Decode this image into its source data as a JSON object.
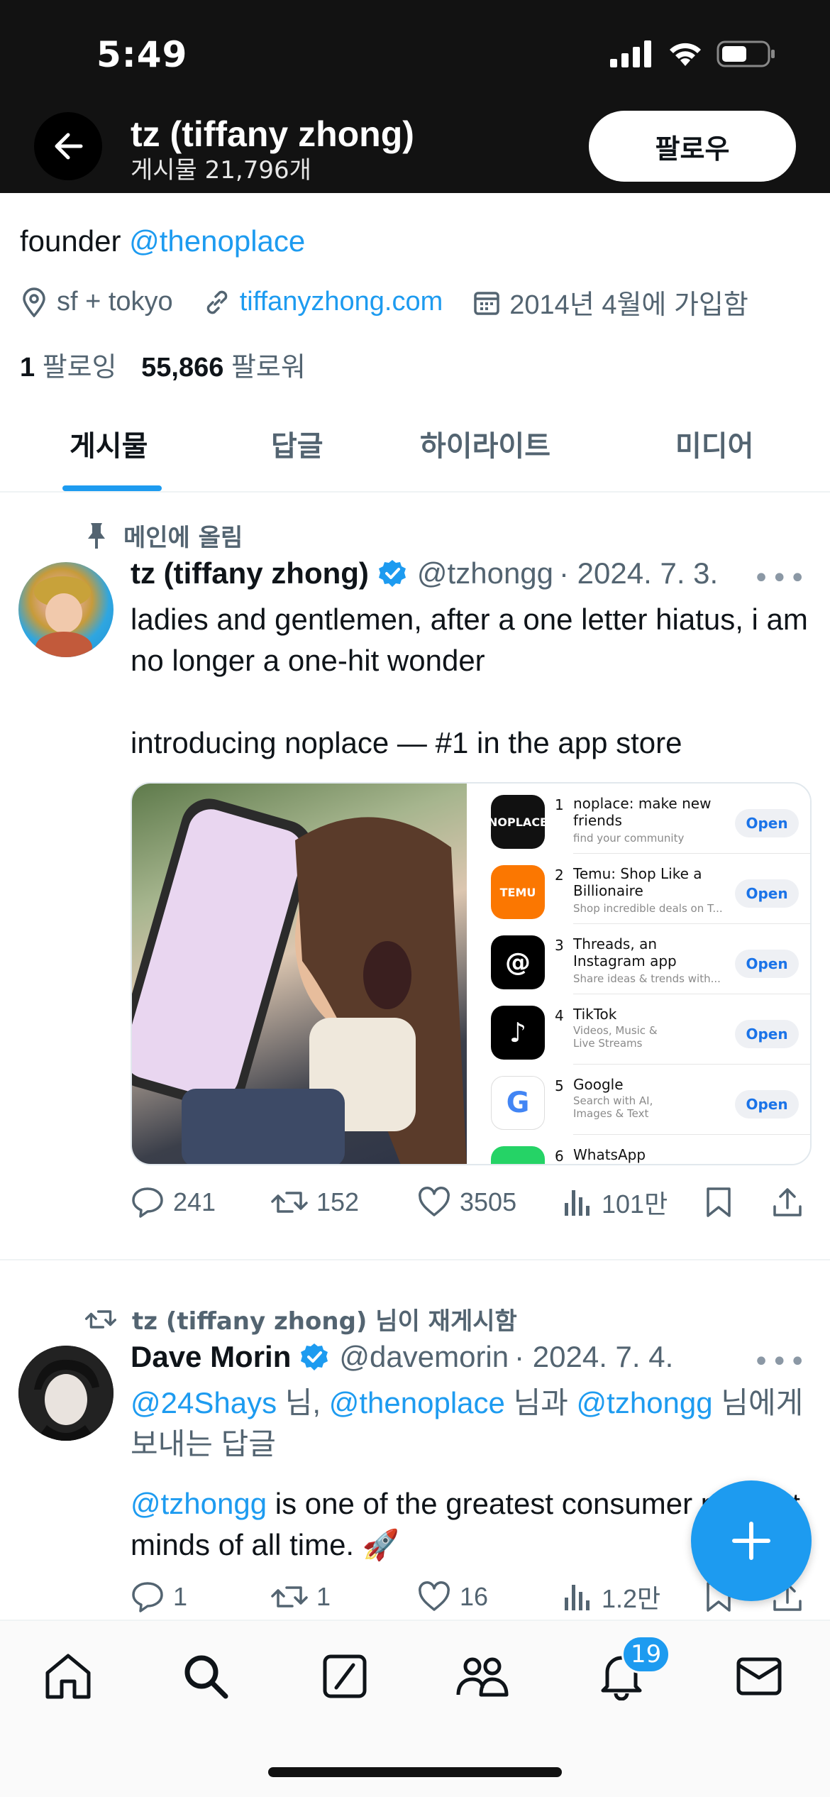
{
  "status_bar": {
    "time": "5:49"
  },
  "header": {
    "title": "tz (tiffany zhong)",
    "post_count": "게시물 21,796개",
    "follow_label": "팔로우"
  },
  "profile": {
    "bio_text": "founder ",
    "bio_link": "@thenoplace",
    "location": "sf + tokyo",
    "website": "tiffanyzhong.com",
    "joined": "2014년 4월에 가입함",
    "following_count": "1",
    "following_label": "팔로잉",
    "followers_count": "55,866",
    "followers_label": "팔로워"
  },
  "tabs": [
    {
      "label": "게시물",
      "active": true
    },
    {
      "label": "답글",
      "active": false
    },
    {
      "label": "하이라이트",
      "active": false
    },
    {
      "label": "미디어",
      "active": false
    }
  ],
  "tweets": [
    {
      "context": "메인에 올림",
      "name": "tz (tiffany zhong)",
      "verified": true,
      "handle": "@tzhongg",
      "date": "· 2024. 7. 3.",
      "text_line1": "ladies and gentlemen, after a one letter hiatus, i am no longer a one-hit wonder",
      "text_line2": "introducing noplace — #1 in the app store",
      "replies": "241",
      "reposts": "152",
      "likes": "3505",
      "views": "101만"
    },
    {
      "context": "tz (tiffany zhong) 님이 재게시함",
      "name": "Dave Morin",
      "verified": true,
      "handle": "@davemorin",
      "date": "· 2024. 7. 4.",
      "reply_to_a": "@24Shays",
      "reply_to_b": " 님, ",
      "reply_to_c": "@thenoplace",
      "reply_to_d": " 님과 ",
      "reply_to_e": "@tzhongg",
      "reply_to_f": " 님에게 보내는 답글",
      "mention": "@tzhongg",
      "text": " is one of the greatest consumer product minds of all time. 🚀",
      "replies": "1",
      "reposts": "1",
      "likes": "16",
      "views": "1.2만"
    }
  ],
  "app_store": [
    {
      "rank": "1",
      "name": "noplace: make new friends",
      "sub": "find your community",
      "icon_label": "NOPLACE",
      "color": "#111111",
      "button": "Open"
    },
    {
      "rank": "2",
      "name": "Temu: Shop Like a Billionaire",
      "sub": "Shop incredible deals on T...",
      "icon_label": "TEMU",
      "color": "#fb7701",
      "button": "Open"
    },
    {
      "rank": "3",
      "name": "Threads, an Instagram app",
      "sub": "Share ideas & trends with...",
      "icon_label": "@",
      "color": "#000000",
      "button": "Open"
    },
    {
      "rank": "4",
      "name": "TikTok",
      "sub": "Videos, Music & Live Streams",
      "icon_label": "♪",
      "color": "#000000",
      "button": "Open"
    },
    {
      "rank": "5",
      "name": "Google",
      "sub": "Search with AI, Images & Text",
      "icon_label": "G",
      "color": "#ffffff",
      "button": "Open"
    },
    {
      "rank": "6",
      "name": "WhatsApp Messenger",
      "sub": "",
      "icon_label": "",
      "color": "#25d366",
      "button": ""
    }
  ],
  "bottom_nav": {
    "notification_count": "19"
  },
  "colors": {
    "accent": "#1d9bf0",
    "header_bg": "#121212"
  }
}
